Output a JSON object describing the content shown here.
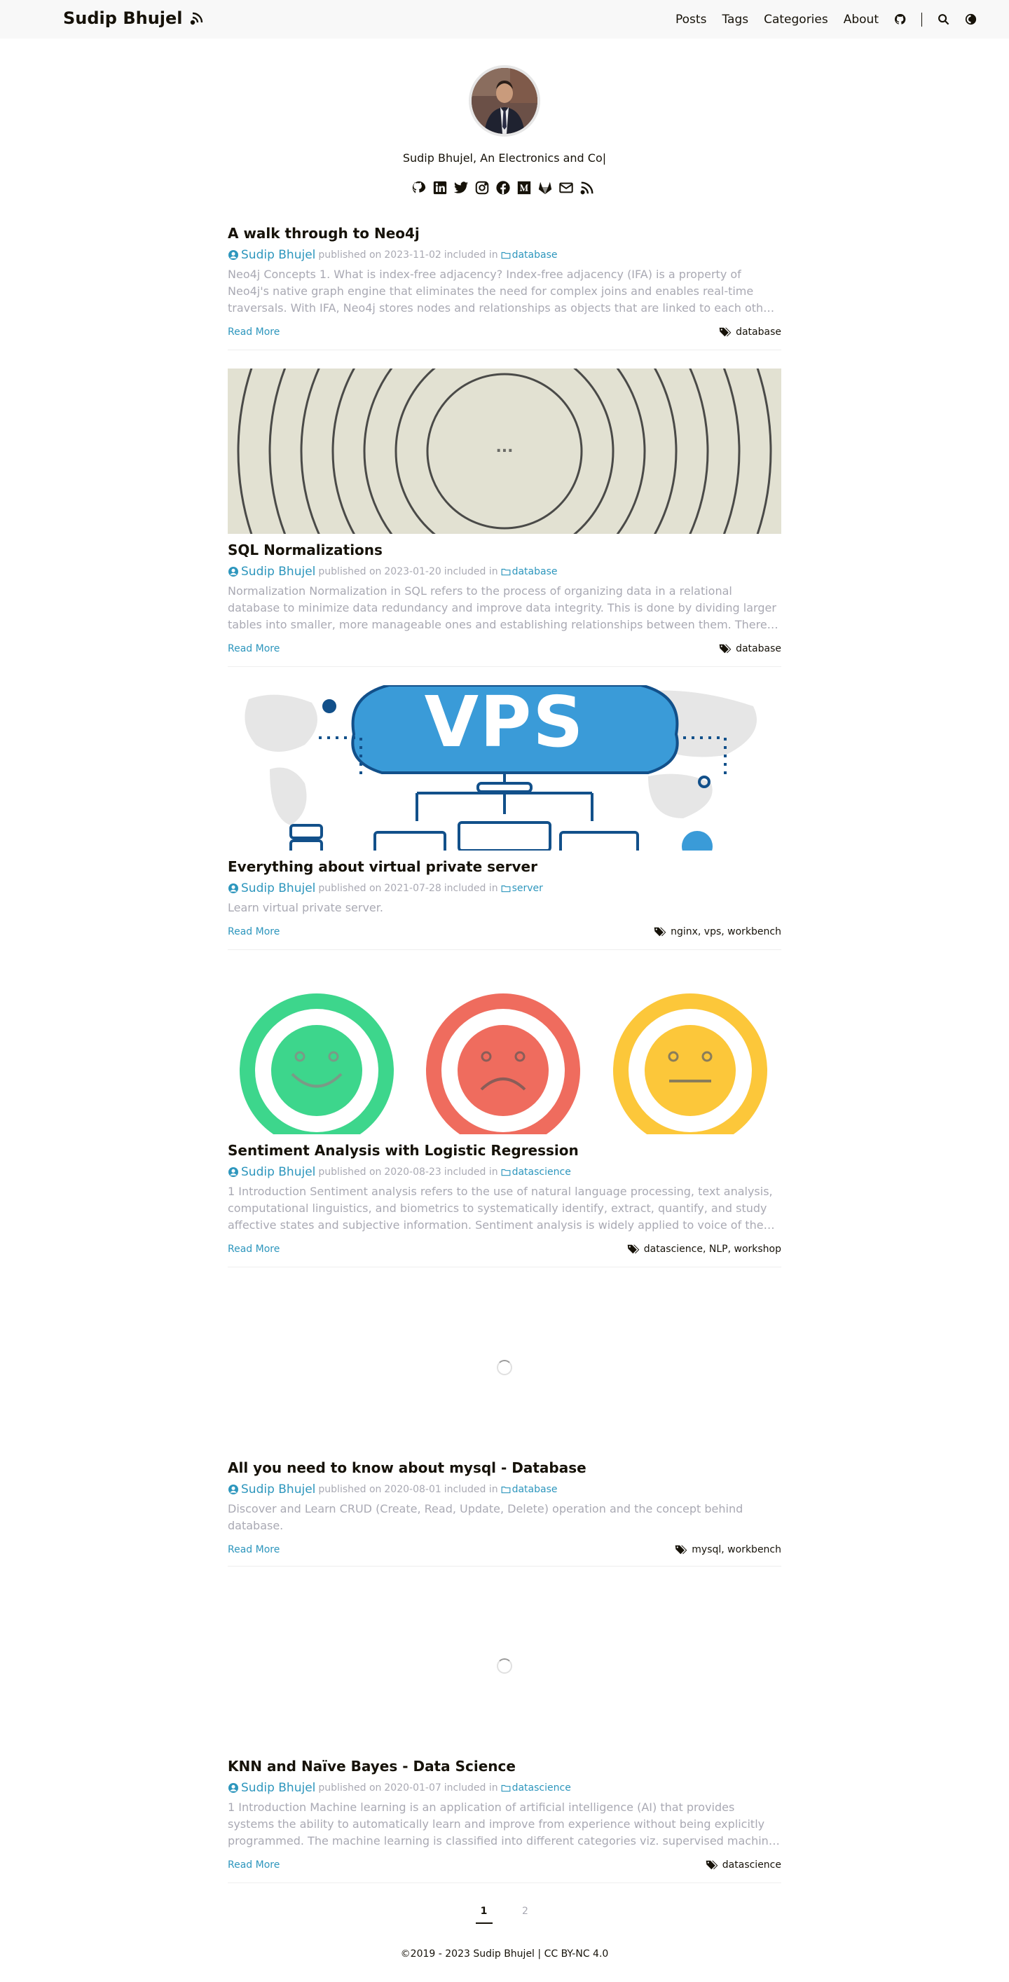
{
  "site": {
    "brand": "Sudip Bhujel",
    "nav": [
      "Posts",
      "Tags",
      "Categories",
      "About"
    ],
    "subtitle": "Sudip Bhujel, An Electronics and Co|"
  },
  "social_icons": [
    "github-icon",
    "linkedin-icon",
    "twitter-icon",
    "instagram-icon",
    "facebook-icon",
    "medium-icon",
    "gitlab-icon",
    "email-icon",
    "rss-icon"
  ],
  "posts": [
    {
      "title": "A walk through to Neo4j",
      "author": "Sudip Bhujel",
      "published_prefix": "published on",
      "date": "2023-11-02",
      "included_prefix": "included in",
      "category": "database",
      "summary": "Neo4j Concepts 1. What is index-free adjacency? Index-free adjacency (IFA) is a property of Neo4j's native graph engine that eliminates the need for complex joins and enables real-time traversals. With IFA, Neo4j stores nodes and relationships as objects that are linked to each oth…",
      "read_more": "Read More",
      "tags": "database"
    },
    {
      "title": "SQL Normalizations",
      "author": "Sudip Bhujel",
      "published_prefix": "published on",
      "date": "2023-01-20",
      "included_prefix": "included in",
      "category": "database",
      "summary": "Normalization Normalization in SQL refers to the process of organizing data in a relational database to minimize data redundancy and improve data integrity. This is done by dividing larger tables into smaller, more manageable ones and establishing relationships between them. There…",
      "read_more": "Read More",
      "tags": "database",
      "cover_text": "..."
    },
    {
      "title": "Everything about virtual private server",
      "author": "Sudip Bhujel",
      "published_prefix": "published on",
      "date": "2021-07-28",
      "included_prefix": "included in",
      "category": "server",
      "summary": "Learn virtual private server.",
      "read_more": "Read More",
      "tags": "nginx, vps, workbench",
      "cover_text": "VPS"
    },
    {
      "title": "Sentiment Analysis with Logistic Regression",
      "author": "Sudip Bhujel",
      "published_prefix": "published on",
      "date": "2020-08-23",
      "included_prefix": "included in",
      "category": "datascience",
      "summary": "1 Introduction Sentiment analysis refers to the use of natural language processing, text analysis, computational linguistics, and biometrics to systematically identify, extract, quantify, and study affective states and subjective information. Sentiment analysis is widely applied to voice of the…",
      "read_more": "Read More",
      "tags": "datascience, NLP, workshop"
    },
    {
      "title": "All you need to know about mysql - Database",
      "author": "Sudip Bhujel",
      "published_prefix": "published on",
      "date": "2020-08-01",
      "included_prefix": "included in",
      "category": "database",
      "summary": "Discover and Learn CRUD (Create, Read, Update, Delete) operation and the concept behind database.",
      "read_more": "Read More",
      "tags": "mysql, workbench"
    },
    {
      "title": "KNN and Naïve Bayes - Data Science",
      "author": "Sudip Bhujel",
      "published_prefix": "published on",
      "date": "2020-01-07",
      "included_prefix": "included in",
      "category": "datascience",
      "summary": "1 Introduction Machine learning is an application of artificial intelligence (AI) that provides systems the ability to automatically learn and improve from experience without being explicitly programmed. The machine learning is classified into different categories viz. supervised machin…",
      "read_more": "Read More",
      "tags": "datascience"
    }
  ],
  "pagination": [
    "1",
    "2"
  ],
  "copyright": "©2019 - 2023 Sudip Bhujel | CC BY-NC 4.0",
  "colors": {
    "link": "#2d96bd",
    "muted": "#a9a9b3",
    "text": "#161209",
    "header_bg": "#f8f8f8"
  }
}
